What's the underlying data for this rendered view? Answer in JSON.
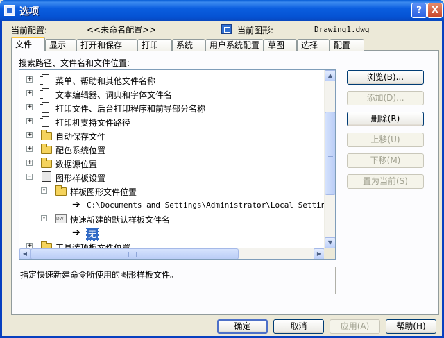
{
  "window": {
    "title": "选项"
  },
  "titlebar": {
    "help_glyph": "?",
    "close_glyph": "X"
  },
  "profile": {
    "current_label": "当前配置:",
    "current_value": "<<未命名配置>>",
    "drawing_label": "当前图形:",
    "drawing_value": "Drawing1.dwg"
  },
  "tabs": [
    {
      "label": "文件",
      "active": true
    },
    {
      "label": "显示"
    },
    {
      "label": "打开和保存"
    },
    {
      "label": "打印"
    },
    {
      "label": "系统"
    },
    {
      "label": "用户系统配置"
    },
    {
      "label": "草图"
    },
    {
      "label": "选择"
    },
    {
      "label": "配置"
    }
  ],
  "section_label": "搜索路径、文件名和文件位置:",
  "tree": {
    "items": [
      {
        "label": "菜单、帮助和其他文件名称",
        "icon": "document-icon",
        "expander": "+"
      },
      {
        "label": "文本编辑器、词典和字体文件名",
        "icon": "document-icon",
        "expander": "+"
      },
      {
        "label": "打印文件、后台打印程序和前导部分名称",
        "icon": "document-icon",
        "expander": "+"
      },
      {
        "label": "打印机支持文件路径",
        "icon": "document-icon",
        "expander": "+"
      },
      {
        "label": "自动保存文件",
        "icon": "folder-icon",
        "expander": "+"
      },
      {
        "label": "配色系统位置",
        "icon": "folder-icon",
        "expander": "+"
      },
      {
        "label": "数据源位置",
        "icon": "folder-icon",
        "expander": "+"
      },
      {
        "label": "图形样板设置",
        "icon": "template-icon",
        "expander": "-"
      },
      {
        "label": "样板图形文件位置",
        "icon": "folder-icon",
        "expander": "-"
      },
      {
        "label": "C:\\Documents and Settings\\Administrator\\Local Settings\\Ap",
        "icon": "arrow-icon"
      },
      {
        "label": "快速新建的默认样板文件名",
        "icon": "dwt-icon",
        "expander": "-"
      },
      {
        "label": "无",
        "icon": "arrow-icon",
        "selected": true
      },
      {
        "label": "工具选项板文件位置",
        "icon": "folder-icon",
        "expander": "+"
      }
    ]
  },
  "scroll": {
    "up": "▲",
    "down": "▼",
    "left": "◀",
    "right": "▶"
  },
  "side_buttons": {
    "browse": "浏览(B)...",
    "add": "添加(D)...",
    "delete": "删除(R)",
    "move_up": "上移(U)",
    "move_down": "下移(M)",
    "set_current": "置为当前(S)"
  },
  "description": "指定快速新建命令所使用的图形样板文件。",
  "footer_buttons": {
    "ok": "确定",
    "cancel": "取消",
    "apply": "应用(A)",
    "help": "帮助(H)"
  },
  "icon_names": {
    "dwt_badge": "DWT"
  }
}
